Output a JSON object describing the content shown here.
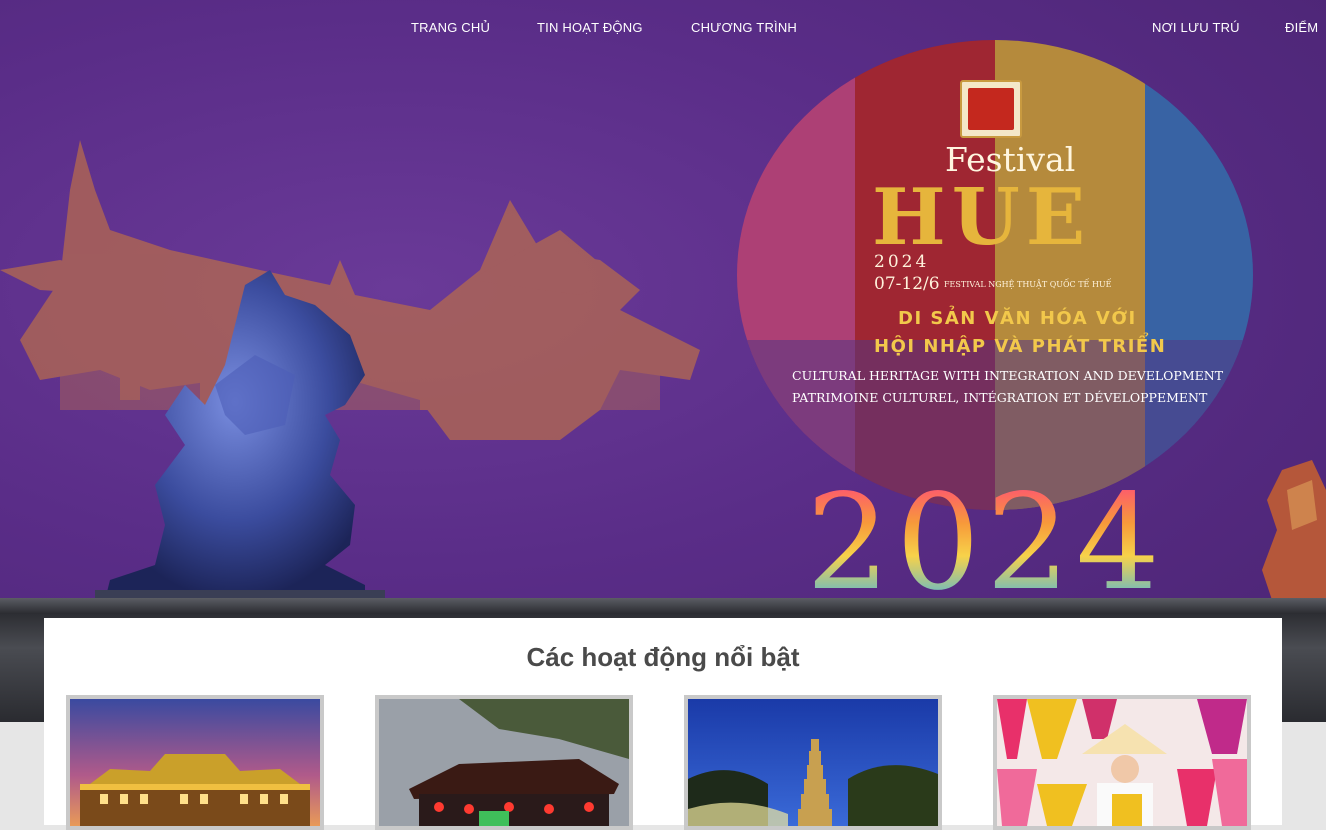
{
  "nav": {
    "items": [
      {
        "label": "TRANG CHỦ"
      },
      {
        "label": "TIN HOẠT ĐỘNG"
      },
      {
        "label": "CHƯƠNG TRÌNH"
      },
      {
        "label": "NƠI LƯU TRÚ"
      },
      {
        "label": "ĐIỂM"
      }
    ]
  },
  "hero": {
    "festival": "Festival",
    "hue": "HUE",
    "year_small": "2024",
    "dates": "07-12/6",
    "dates_sub": "FESTIVAL NGHỆ THUẬT QUỐC TẾ HUẾ",
    "theme_line1": "DI SẢN VĂN HÓA VỚI",
    "theme_line2": "HỘI NHẬP VÀ PHÁT TRIỂN",
    "tagline_en": "CULTURAL HERITAGE WITH INTEGRATION AND DEVELOPMENT",
    "tagline_fr": "PATRIMOINE CULTUREL, INTÉGRATION ET DÉVELOPPEMENT",
    "big_year": "2024"
  },
  "section": {
    "title": "Các hoạt động nổi bật"
  },
  "colors": {
    "hero_purple": "#5a2d88",
    "accent_gold": "#e6b53c",
    "theme_yellow": "#f2c84b",
    "title_gray": "#4a4a4a"
  }
}
